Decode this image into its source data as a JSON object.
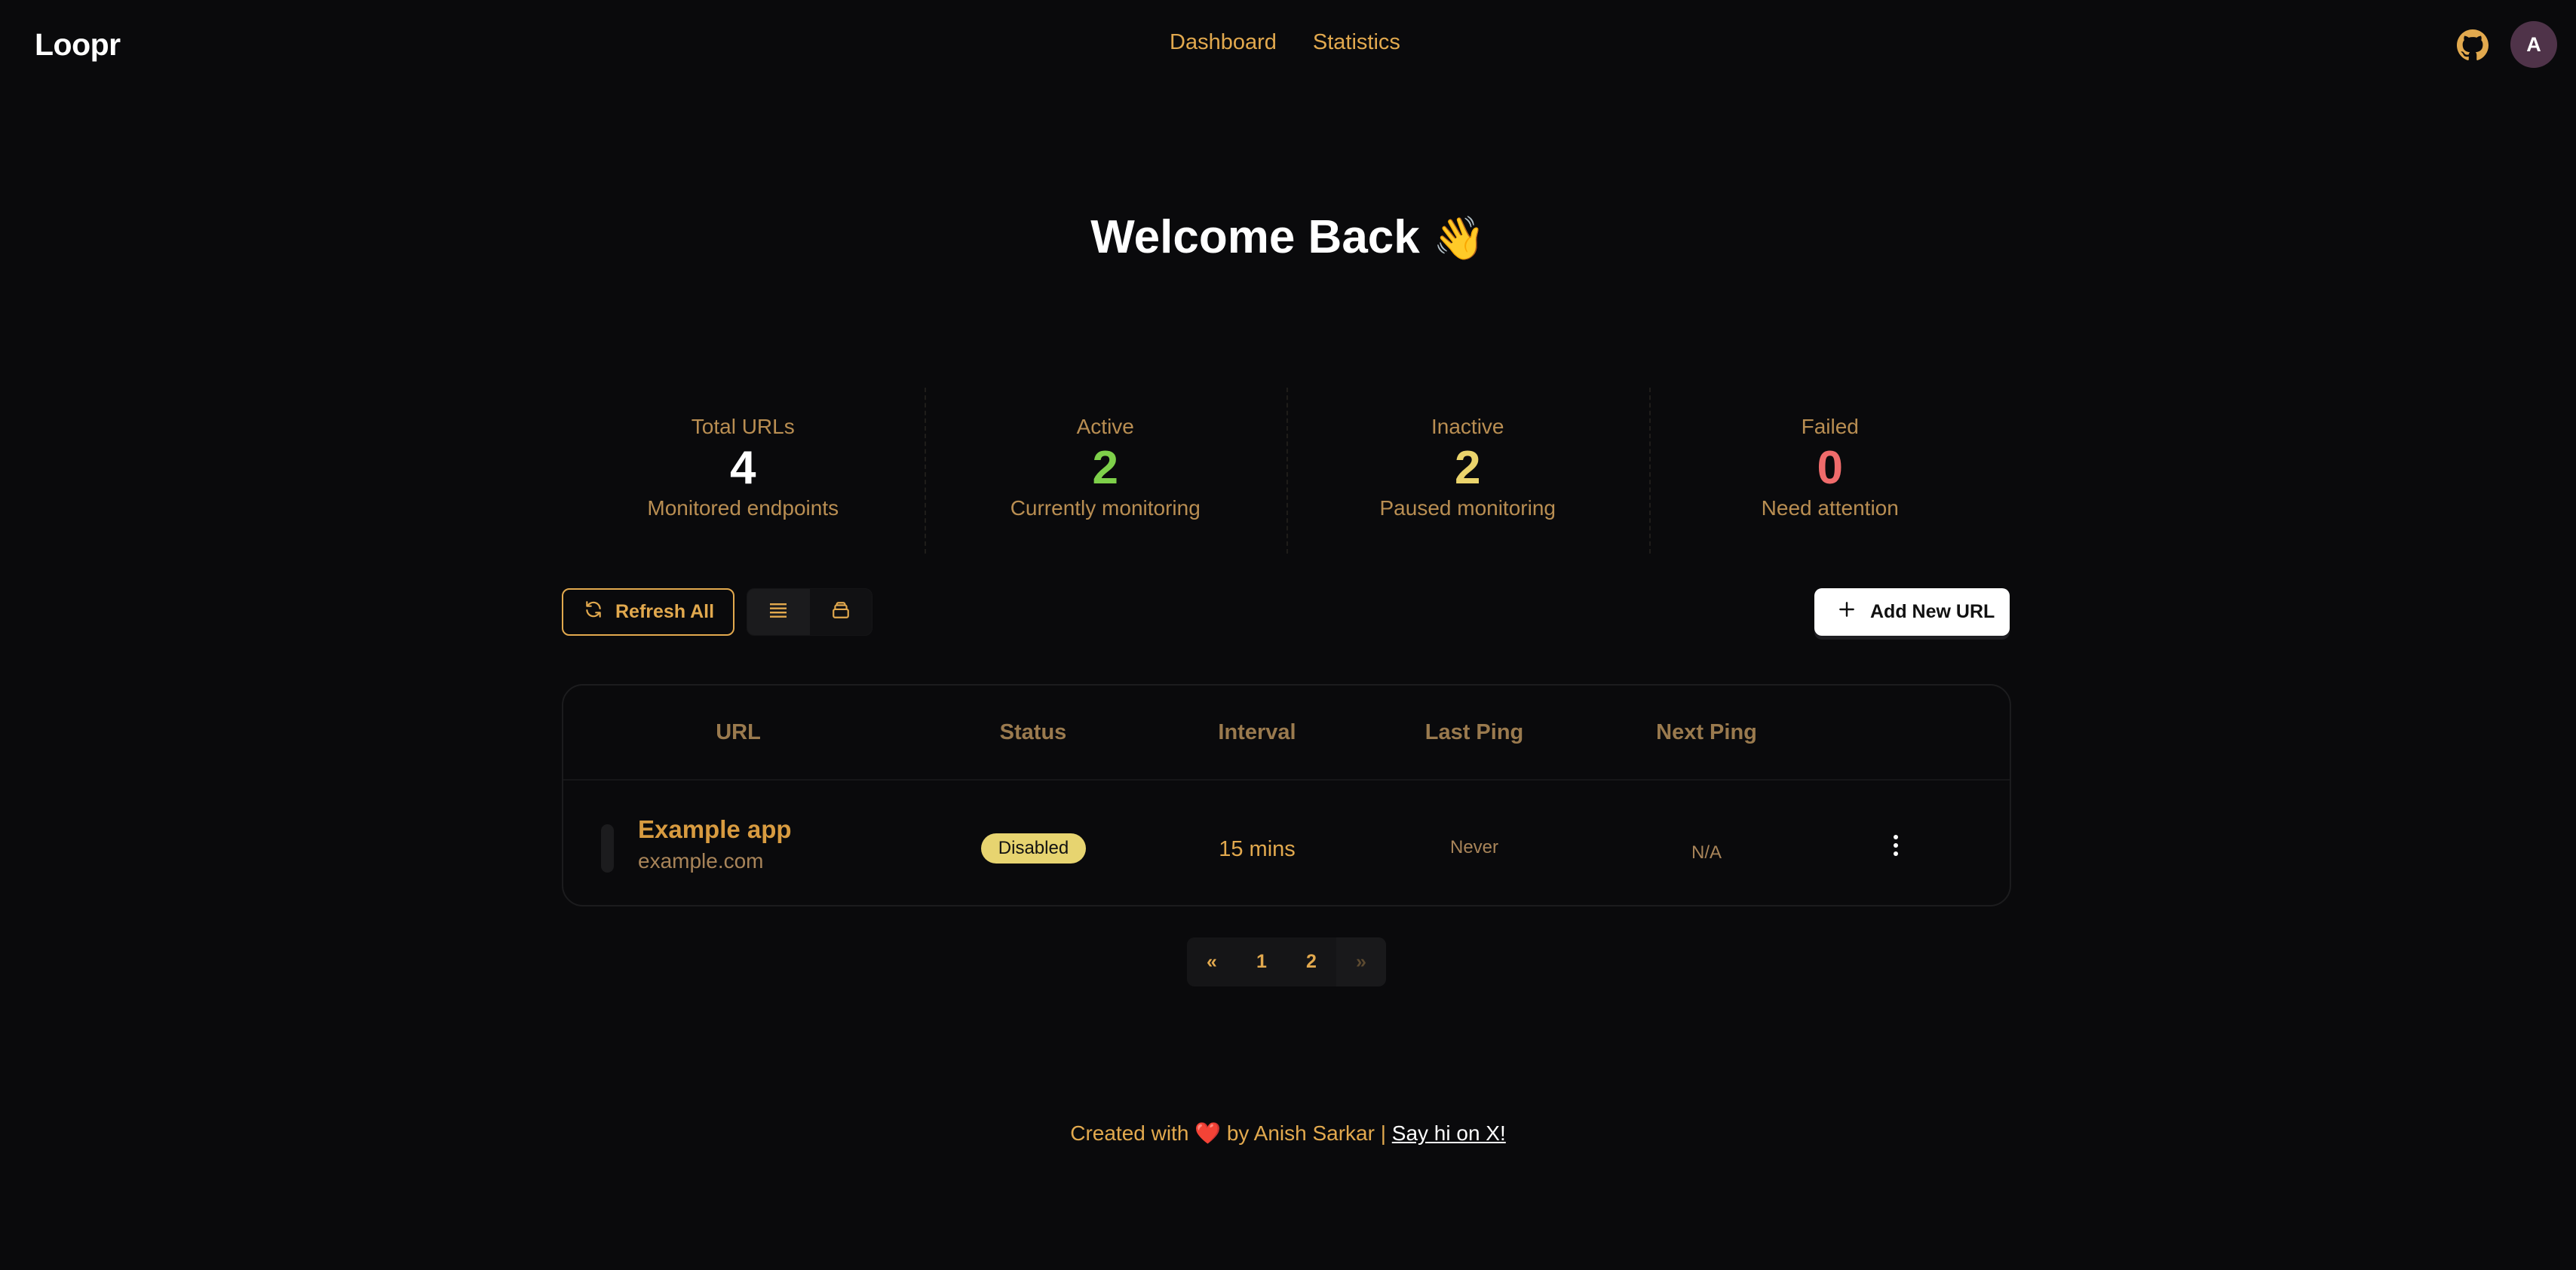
{
  "app": {
    "name": "Loopr"
  },
  "nav": {
    "items": [
      "Dashboard",
      "Statistics"
    ]
  },
  "user": {
    "avatar_initial": "A"
  },
  "page": {
    "title": "Welcome Back",
    "title_emoji": "👋"
  },
  "stats": [
    {
      "title": "Total URLs",
      "value": "4",
      "desc": "Monitored endpoints",
      "color": "#ffffff"
    },
    {
      "title": "Active",
      "value": "2",
      "desc": "Currently monitoring",
      "color": "#7ed04a"
    },
    {
      "title": "Inactive",
      "value": "2",
      "desc": "Paused monitoring",
      "color": "#ebd46c"
    },
    {
      "title": "Failed",
      "value": "0",
      "desc": "Need attention",
      "color": "#ef6b6b"
    }
  ],
  "toolbar": {
    "refresh_label": "Refresh All",
    "add_label": "Add New URL",
    "views": [
      "list-view",
      "card-view"
    ]
  },
  "table": {
    "columns": [
      "URL",
      "Status",
      "Interval",
      "Last Ping",
      "Next Ping"
    ],
    "rows": [
      {
        "name": "Example app",
        "url": "example.com",
        "status": "Disabled",
        "interval": "15 mins",
        "last_ping": "Never",
        "next_ping": "N/A"
      }
    ]
  },
  "pagination": {
    "prev": "«",
    "pages": [
      "1",
      "2"
    ],
    "next": "»"
  },
  "footer": {
    "prefix": "Created with",
    "heart": "❤️",
    "middle": "by Anish Sarkar |",
    "link": "Say hi on X!"
  },
  "colors": {
    "accent": "#e2a94e",
    "background": "#0a0a0c",
    "badge_disabled": "#e7d470"
  }
}
